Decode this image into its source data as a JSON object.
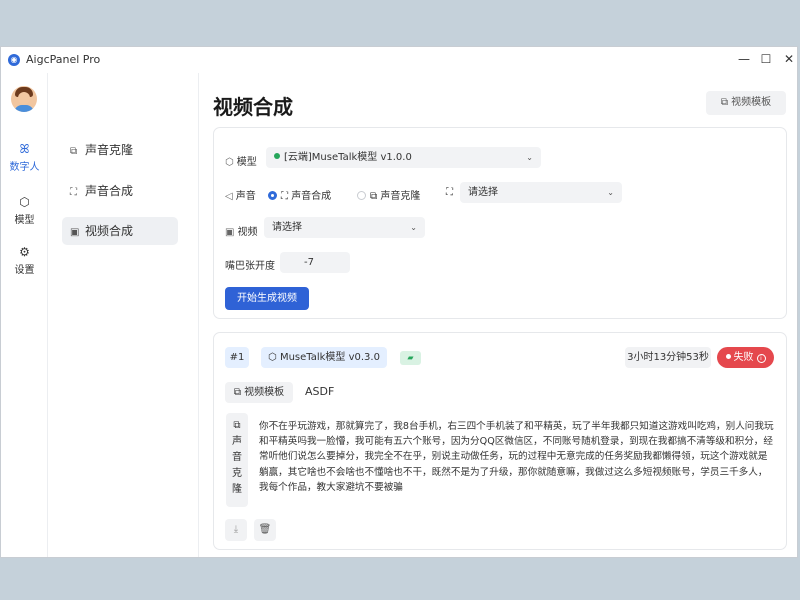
{
  "window": {
    "title": "AigcPanel Pro",
    "controls": {
      "minimize": "—",
      "maximize": "☐",
      "close": "✕"
    }
  },
  "rail": {
    "items": [
      {
        "icon": "digital-human-icon",
        "glyph": "ꕤ",
        "label": "数字人",
        "active": true
      },
      {
        "icon": "model-icon",
        "glyph": "⬡",
        "label": "模型",
        "active": false
      },
      {
        "icon": "settings-icon",
        "glyph": "⚙",
        "label": "设置",
        "active": false
      }
    ]
  },
  "subnav": {
    "items": [
      {
        "icon": "voice-clone-icon",
        "glyph": "⧉",
        "label": "声音克隆"
      },
      {
        "icon": "voice-synth-icon",
        "glyph": "⛶",
        "label": "声音合成"
      },
      {
        "icon": "video-synth-icon",
        "glyph": "▣",
        "label": "视频合成",
        "active": true
      }
    ]
  },
  "main": {
    "title": "视频合成",
    "template_button": "视频模板",
    "form": {
      "model_label": "模型",
      "model_value": "[云端]MuseTalk模型 v1.0.0",
      "voice_label": "声音",
      "voice_option_synth": "声音合成",
      "voice_option_clone": "声音克隆",
      "voice_select_placeholder": "请选择",
      "video_label": "视频",
      "video_select_placeholder": "请选择",
      "mouth_label": "嘴巴张开度",
      "mouth_value": "-7",
      "submit_button": "开始生成视频"
    },
    "task": {
      "index": "#1",
      "model": "MuseTalk模型 v0.3.0",
      "duration": "3小时13分钟53秒",
      "status": "失败",
      "video_template_tag": "视频模板",
      "video_template_value": "ASDF",
      "voice_clone_label": "声音克隆",
      "text": "你不在乎玩游戏，那就算完了，我8台手机，右三四个手机装了和平精英，玩了半年我都只知道这游戏叫吃鸡，别人问我玩和平精英吗我一脸懵，我可能有五六个账号，因为分QQ区微信区，不同账号随机登录，到现在我都搞不清等级和积分，经常听他们说怎么要掉分，我完全不在乎，别说主动做任务，玩的过程中无意完成的任务奖励我都懒得领，玩这个游戏就是躺赢，其它啥也不会啥也不懂啥也不干，既然不是为了升级，那你就随意嘛，我做过这么多短视频账号，学员三千多人，我每个作品，教大家避坑不要被骗"
    }
  },
  "colors": {
    "accent": "#2f62d6",
    "fail": "#e5484d",
    "ok_green": "#26a65b",
    "tag_bg": "#e4efff"
  }
}
